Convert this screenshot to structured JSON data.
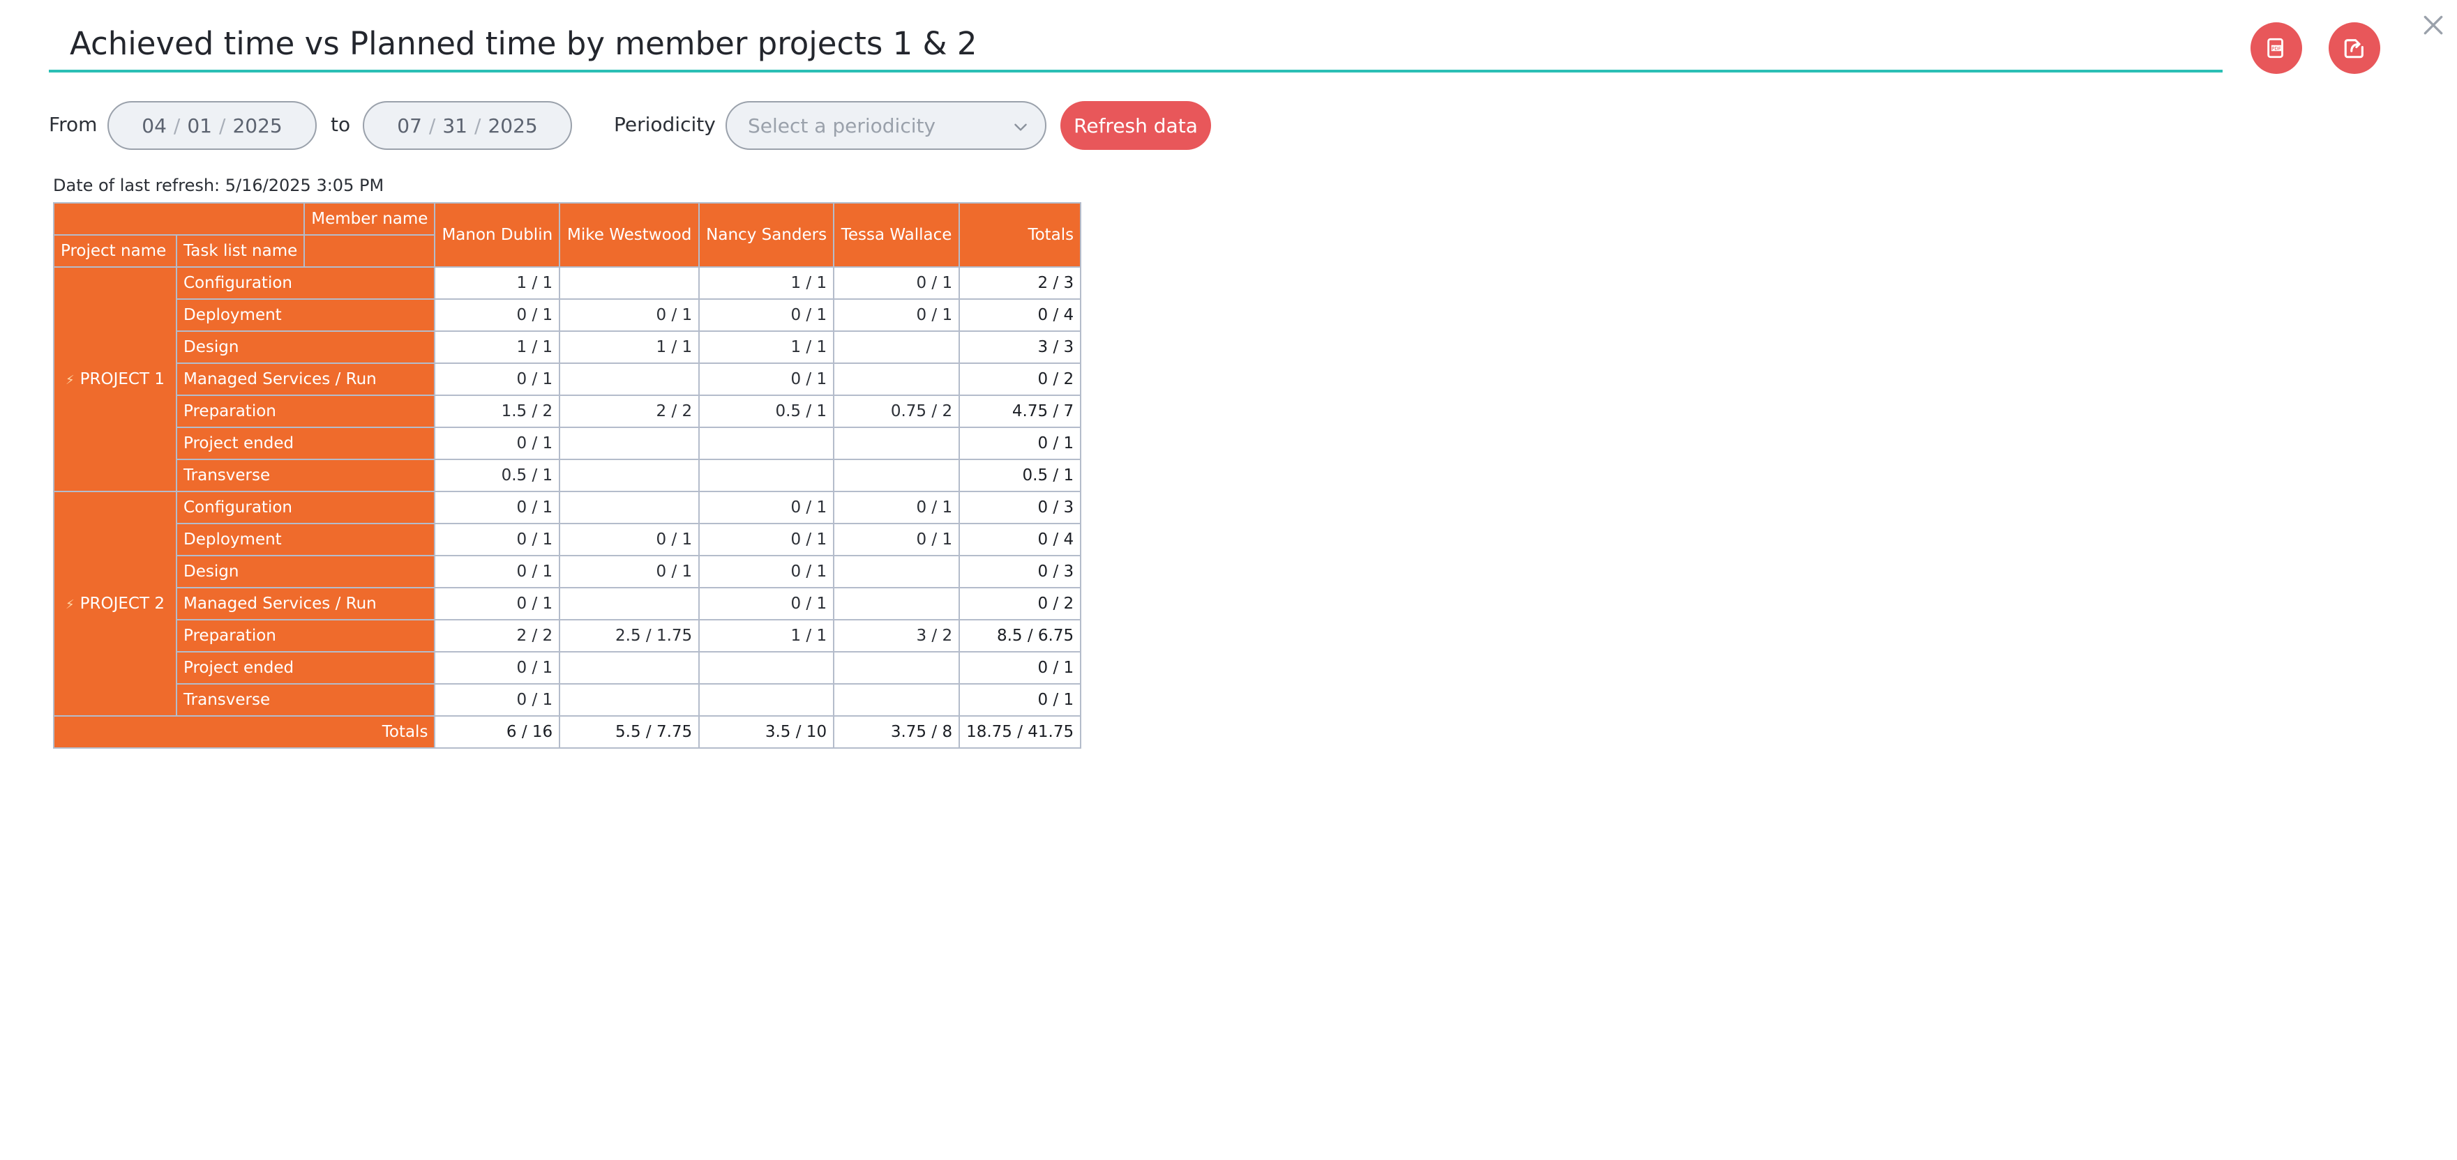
{
  "header": {
    "title": "Achieved time vs Planned time by member projects 1 & 2",
    "pdf_icon": "pdf-icon",
    "export_icon": "export-icon",
    "close_icon": "close-icon"
  },
  "filters": {
    "from_label": "From",
    "from_date": {
      "month": "04",
      "day": "01",
      "year": "2025",
      "sep": "/"
    },
    "to_label": "to",
    "to_date": {
      "month": "07",
      "day": "31",
      "year": "2025",
      "sep": "/"
    },
    "periodicity_label": "Periodicity",
    "periodicity_placeholder": "Select a periodicity",
    "refresh_label": "Refresh data"
  },
  "last_refresh": "Date of last refresh: 5/16/2025 3:05 PM",
  "table": {
    "member_name_header": "Member name",
    "project_name_header": "Project name",
    "task_list_header": "Task list name",
    "members": [
      "Manon Dublin",
      "Mike Westwood",
      "Nancy Sanders",
      "Tessa Wallace"
    ],
    "totals_header": "Totals",
    "projects": [
      {
        "name": "PROJECT 1",
        "rows": [
          {
            "task": "Configuration",
            "cells": [
              "1 / 1",
              "",
              "1 / 1",
              "0 / 1"
            ],
            "total": "2 / 3"
          },
          {
            "task": "Deployment",
            "cells": [
              "0 / 1",
              "0 / 1",
              "0 / 1",
              "0 / 1"
            ],
            "total": "0 / 4"
          },
          {
            "task": "Design",
            "cells": [
              "1 / 1",
              "1 / 1",
              "1 / 1",
              ""
            ],
            "total": "3 / 3"
          },
          {
            "task": "Managed Services / Run",
            "cells": [
              "0 / 1",
              "",
              "0 / 1",
              ""
            ],
            "total": "0 / 2"
          },
          {
            "task": "Preparation",
            "cells": [
              "1.5 / 2",
              "2 / 2",
              "0.5 / 1",
              "0.75 / 2"
            ],
            "total": "4.75 / 7"
          },
          {
            "task": "Project ended",
            "cells": [
              "0 / 1",
              "",
              "",
              ""
            ],
            "total": "0 / 1"
          },
          {
            "task": "Transverse",
            "cells": [
              "0.5 / 1",
              "",
              "",
              ""
            ],
            "total": "0.5 / 1"
          }
        ]
      },
      {
        "name": "PROJECT 2",
        "rows": [
          {
            "task": "Configuration",
            "cells": [
              "0 / 1",
              "",
              "0 / 1",
              "0 / 1"
            ],
            "total": "0 / 3"
          },
          {
            "task": "Deployment",
            "cells": [
              "0 / 1",
              "0 / 1",
              "0 / 1",
              "0 / 1"
            ],
            "total": "0 / 4"
          },
          {
            "task": "Design",
            "cells": [
              "0 / 1",
              "0 / 1",
              "0 / 1",
              ""
            ],
            "total": "0 / 3"
          },
          {
            "task": "Managed Services / Run",
            "cells": [
              "0 / 1",
              "",
              "0 / 1",
              ""
            ],
            "total": "0 / 2"
          },
          {
            "task": "Preparation",
            "cells": [
              "2 / 2",
              "2.5 / 1.75",
              "1 / 1",
              "3 / 2"
            ],
            "total": "8.5 / 6.75"
          },
          {
            "task": "Project ended",
            "cells": [
              "0 / 1",
              "",
              "",
              ""
            ],
            "total": "0 / 1"
          },
          {
            "task": "Transverse",
            "cells": [
              "0 / 1",
              "",
              "",
              ""
            ],
            "total": "0 / 1"
          }
        ]
      }
    ],
    "footer": {
      "label": "Totals",
      "cells": [
        "6 / 16",
        "5.5 / 7.75",
        "3.5 / 10",
        "3.75 / 8"
      ],
      "total": "18.75 / 41.75"
    }
  }
}
